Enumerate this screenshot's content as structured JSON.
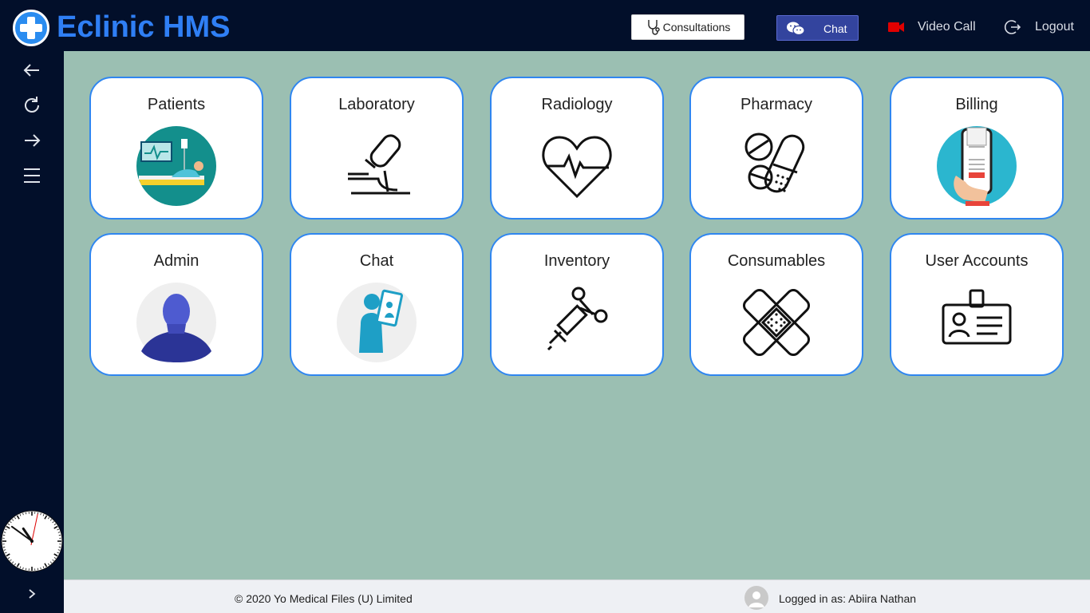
{
  "header": {
    "app_title": "Eclinic HMS",
    "consultations_label": "Consultations",
    "chat_label": "Chat",
    "video_call_label": "Video Call",
    "logout_label": "Logout"
  },
  "sidebar": {
    "icons": [
      "back-arrow-icon",
      "refresh-icon",
      "forward-arrow-icon",
      "menu-icon"
    ],
    "expand_icon": "chevron-right-icon"
  },
  "clock": {
    "hour": 10,
    "minute": 51,
    "second": 2
  },
  "tiles": [
    {
      "label": "Patients",
      "icon": "patient-bed-icon"
    },
    {
      "label": "Laboratory",
      "icon": "microscope-icon"
    },
    {
      "label": "Radiology",
      "icon": "heartbeat-icon"
    },
    {
      "label": "Pharmacy",
      "icon": "pills-icon"
    },
    {
      "label": "Billing",
      "icon": "mobile-pay-icon"
    },
    {
      "label": "Admin",
      "icon": "admin-avatar-icon"
    },
    {
      "label": "Chat",
      "icon": "doctor-tablet-icon"
    },
    {
      "label": "Inventory",
      "icon": "syringe-icon"
    },
    {
      "label": "Consumables",
      "icon": "bandage-icon"
    },
    {
      "label": "User Accounts",
      "icon": "id-card-icon"
    }
  ],
  "footer": {
    "copyright": "© 2020 Yo Medical Files (U) Limited",
    "logged_in": "Logged in as: Abiira Nathan"
  },
  "colors": {
    "topbar": "#020f2a",
    "brand": "#2f7ff5",
    "content_bg": "#9bbfb2",
    "tile_border": "#2f86f0",
    "chat_button": "#33449e",
    "video_icon": "#e00000"
  }
}
